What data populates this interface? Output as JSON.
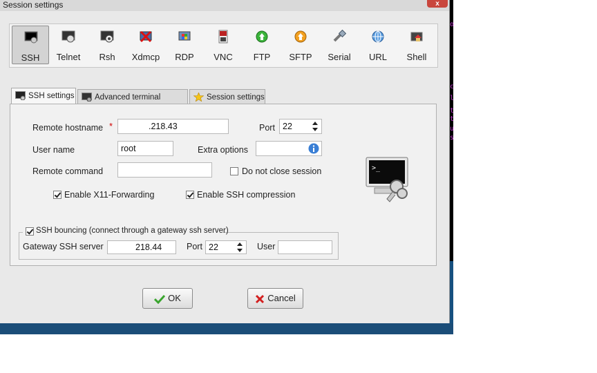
{
  "window": {
    "title": "Session settings",
    "close_label": "x"
  },
  "toolbar": {
    "items": [
      {
        "label": "SSH",
        "icon": "ssh-terminal-icon"
      },
      {
        "label": "Telnet",
        "icon": "telnet-icon"
      },
      {
        "label": "Rsh",
        "icon": "rsh-icon"
      },
      {
        "label": "Xdmcp",
        "icon": "xdmcp-icon"
      },
      {
        "label": "RDP",
        "icon": "rdp-icon"
      },
      {
        "label": "VNC",
        "icon": "vnc-icon"
      },
      {
        "label": "FTP",
        "icon": "ftp-icon"
      },
      {
        "label": "SFTP",
        "icon": "sftp-icon"
      },
      {
        "label": "Serial",
        "icon": "serial-icon"
      },
      {
        "label": "URL",
        "icon": "url-globe-icon"
      },
      {
        "label": "Shell",
        "icon": "shell-house-icon"
      }
    ],
    "selected": "SSH"
  },
  "tabs": [
    {
      "label": "SSH settings",
      "icon": "terminal-icon"
    },
    {
      "label": "Advanced terminal settings",
      "icon": "terminal-gear-icon"
    },
    {
      "label": "Session settings",
      "icon": "star-icon"
    }
  ],
  "ssh": {
    "remote_hostname_label": "Remote hostname",
    "required_mark": "*",
    "remote_hostname_value": ".218.43",
    "port_label": "Port",
    "port_value": "22",
    "user_name_label": "User name",
    "user_name_value": "root",
    "extra_options_label": "Extra options",
    "extra_options_value": "",
    "remote_command_label": "Remote command",
    "remote_command_value": "",
    "do_not_close_label": "Do not close session",
    "do_not_close_checked": false,
    "x11_label": "Enable X11-Forwarding",
    "x11_checked": true,
    "compression_label": "Enable SSH compression",
    "compression_checked": true
  },
  "bouncing": {
    "label": "SSH bouncing (connect through a gateway ssh server)",
    "checked": true,
    "gateway_label": "Gateway SSH server",
    "gateway_value": "218.44",
    "port_label": "Port",
    "port_value": "22",
    "user_label": "User",
    "user_value": ""
  },
  "buttons": {
    "ok_label": "OK",
    "cancel_label": "Cancel"
  },
  "desktop": {
    "side_chars": [
      "o",
      "c",
      "l",
      "t",
      "t",
      "u",
      "s"
    ]
  },
  "colors": {
    "accent_red": "#d10000",
    "dialog_bg": "#e9e9e9",
    "desktop_blue": "#1b4d78"
  }
}
